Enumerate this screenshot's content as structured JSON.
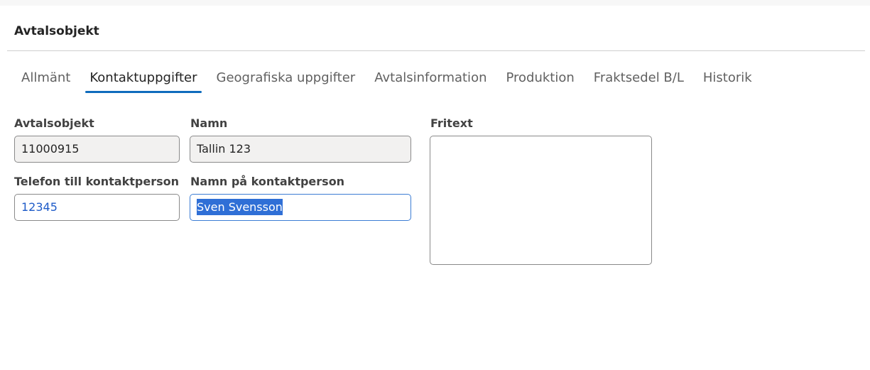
{
  "header": {
    "title": "Avtalsobjekt"
  },
  "tabs": [
    {
      "label": "Allmänt",
      "active": false
    },
    {
      "label": "Kontaktuppgifter",
      "active": true
    },
    {
      "label": "Geografiska uppgifter",
      "active": false
    },
    {
      "label": "Avtalsinformation",
      "active": false
    },
    {
      "label": "Produktion",
      "active": false
    },
    {
      "label": "Fraktsedel B/L",
      "active": false
    },
    {
      "label": "Historik",
      "active": false
    }
  ],
  "form": {
    "avtalsobjekt": {
      "label": "Avtalsobjekt",
      "value": "11000915"
    },
    "namn": {
      "label": "Namn",
      "value": "Tallin 123"
    },
    "telefon": {
      "label": "Telefon till kontaktperson",
      "value": "12345"
    },
    "kontaktperson": {
      "label": "Namn på kontaktperson",
      "value": "Sven Svensson"
    },
    "fritext": {
      "label": "Fritext",
      "value": ""
    }
  },
  "colors": {
    "accent": "#0f6cbd",
    "selection": "#2f6fd6",
    "editable_text": "#1e5bc8",
    "readonly_bg": "#f2f1f0"
  }
}
